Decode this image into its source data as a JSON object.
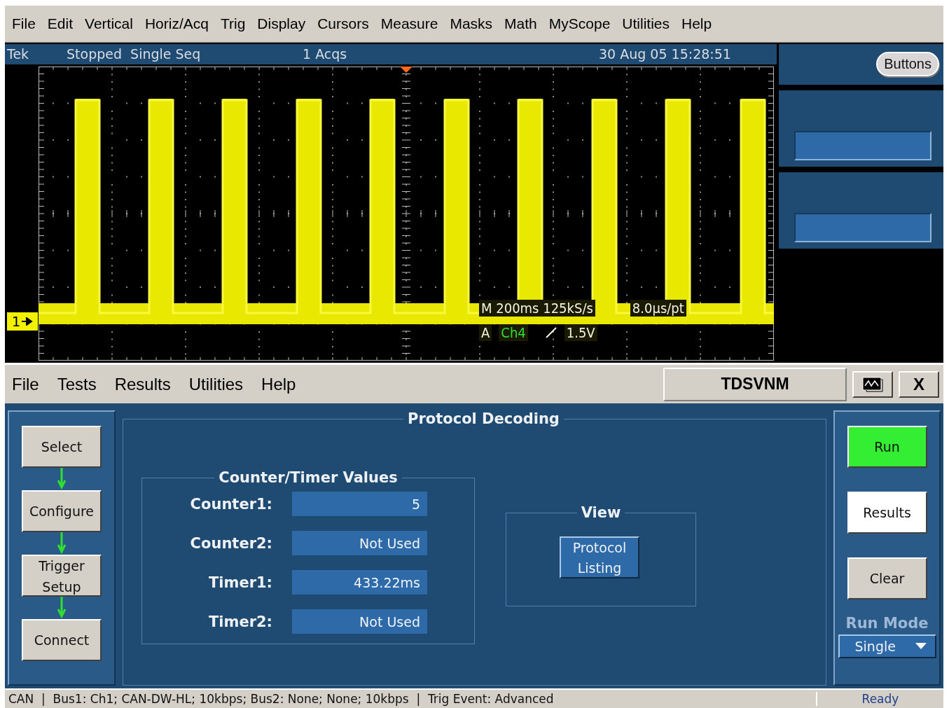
{
  "scope_menu": [
    "File",
    "Edit",
    "Vertical",
    "Horiz/Acq",
    "Trig",
    "Display",
    "Cursors",
    "Measure",
    "Masks",
    "Math",
    "MyScope",
    "Utilities",
    "Help"
  ],
  "scope_status": {
    "brand": "Tek",
    "state": "Stopped  Single Seq",
    "acqs": "1 Acqs",
    "datetime": "30 Aug 05 15:28:51",
    "buttons_label": "Buttons"
  },
  "display": {
    "channel_marker": "1",
    "readout_line1": [
      "M 200ms 125kS/s",
      "8.0µs/pt"
    ],
    "trigger_source_prefix": "A",
    "trigger_channel": "Ch4",
    "trigger_level": "1.5V"
  },
  "app_menu": [
    "File",
    "Tests",
    "Results",
    "Utilities",
    "Help"
  ],
  "app_title": "TDSVNM",
  "close_label": "X",
  "panel_title": "Protocol Decoding",
  "steps": [
    "Select",
    "Configure",
    "Trigger Setup",
    "Connect"
  ],
  "counter_group": {
    "title": "Counter/Timer Values",
    "rows": [
      {
        "label": "Counter1:",
        "value": "5"
      },
      {
        "label": "Counter2:",
        "value": "Not Used"
      },
      {
        "label": "Timer1:",
        "value": "433.22ms"
      },
      {
        "label": "Timer2:",
        "value": "Not Used"
      }
    ]
  },
  "view_group": {
    "title": "View",
    "button": "Protocol Listing"
  },
  "actions": [
    {
      "label": "Run",
      "kind": "run",
      "selected": false
    },
    {
      "label": "Results",
      "kind": "plain",
      "selected": true
    },
    {
      "label": "Clear",
      "kind": "plain",
      "selected": false
    }
  ],
  "run_mode": {
    "label": "Run Mode",
    "value": "Single"
  },
  "status_bar": {
    "summary": "CAN  |  Bus1: Ch1; CAN-DW-HL; 10kbps; Bus2: None; None; 10kbps  |  Trig Event: Advanced",
    "state": "Ready"
  }
}
